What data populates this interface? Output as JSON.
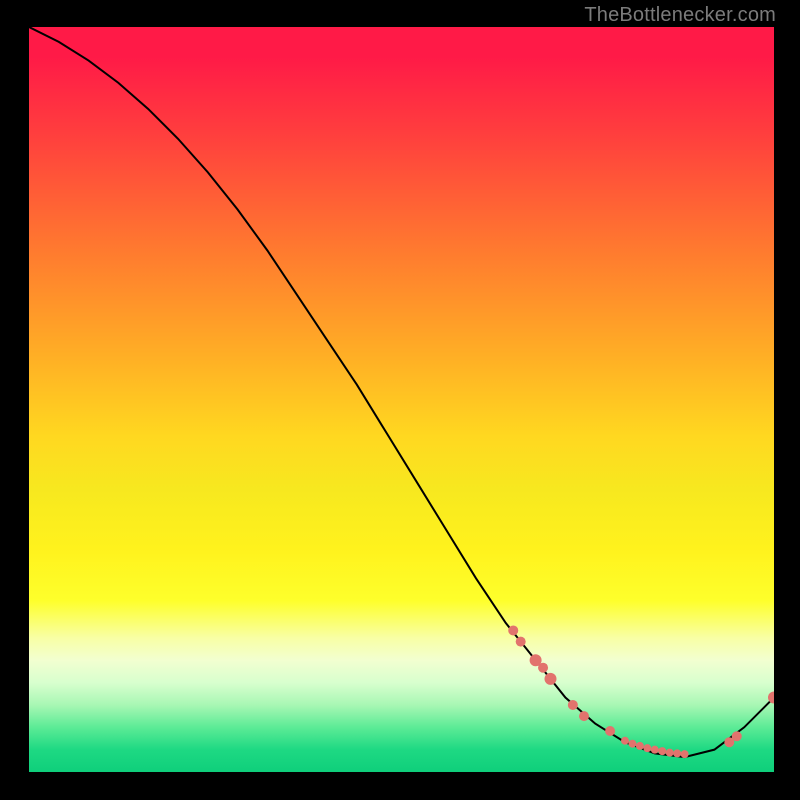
{
  "watermark": {
    "text": "TheBottlenecker.com"
  },
  "chart_data": {
    "type": "line",
    "title": "",
    "xlabel": "",
    "ylabel": "",
    "xlim": [
      0,
      100
    ],
    "ylim": [
      0,
      100
    ],
    "grid": false,
    "series": [
      {
        "name": "curve",
        "style": "line",
        "color": "#000000",
        "x": [
          0,
          4,
          8,
          12,
          16,
          20,
          24,
          28,
          32,
          36,
          40,
          44,
          48,
          52,
          56,
          60,
          64,
          68,
          72,
          76,
          80,
          84,
          88,
          92,
          96,
          100
        ],
        "y": [
          100,
          98,
          95.5,
          92.5,
          89,
          85,
          80.5,
          75.5,
          70,
          64,
          58,
          52,
          45.5,
          39,
          32.5,
          26,
          20,
          15,
          10,
          6.5,
          4,
          2.5,
          2,
          3,
          6,
          10
        ]
      },
      {
        "name": "markers",
        "style": "scatter",
        "color": "#e2736d",
        "x": [
          65,
          66,
          68,
          69,
          70,
          73,
          74.5,
          78,
          80,
          81,
          82,
          83,
          84,
          85,
          86,
          87,
          88,
          94,
          95,
          100
        ],
        "y": [
          19,
          17.5,
          15,
          14,
          12.5,
          9,
          7.5,
          5.5,
          4.2,
          3.8,
          3.5,
          3.2,
          3.0,
          2.8,
          2.6,
          2.5,
          2.4,
          4,
          4.8,
          10
        ],
        "size": [
          5,
          5,
          6,
          5,
          6,
          5,
          5,
          5,
          4,
          4,
          4,
          4,
          4,
          4,
          4,
          4,
          4,
          5,
          5,
          6
        ]
      }
    ]
  }
}
